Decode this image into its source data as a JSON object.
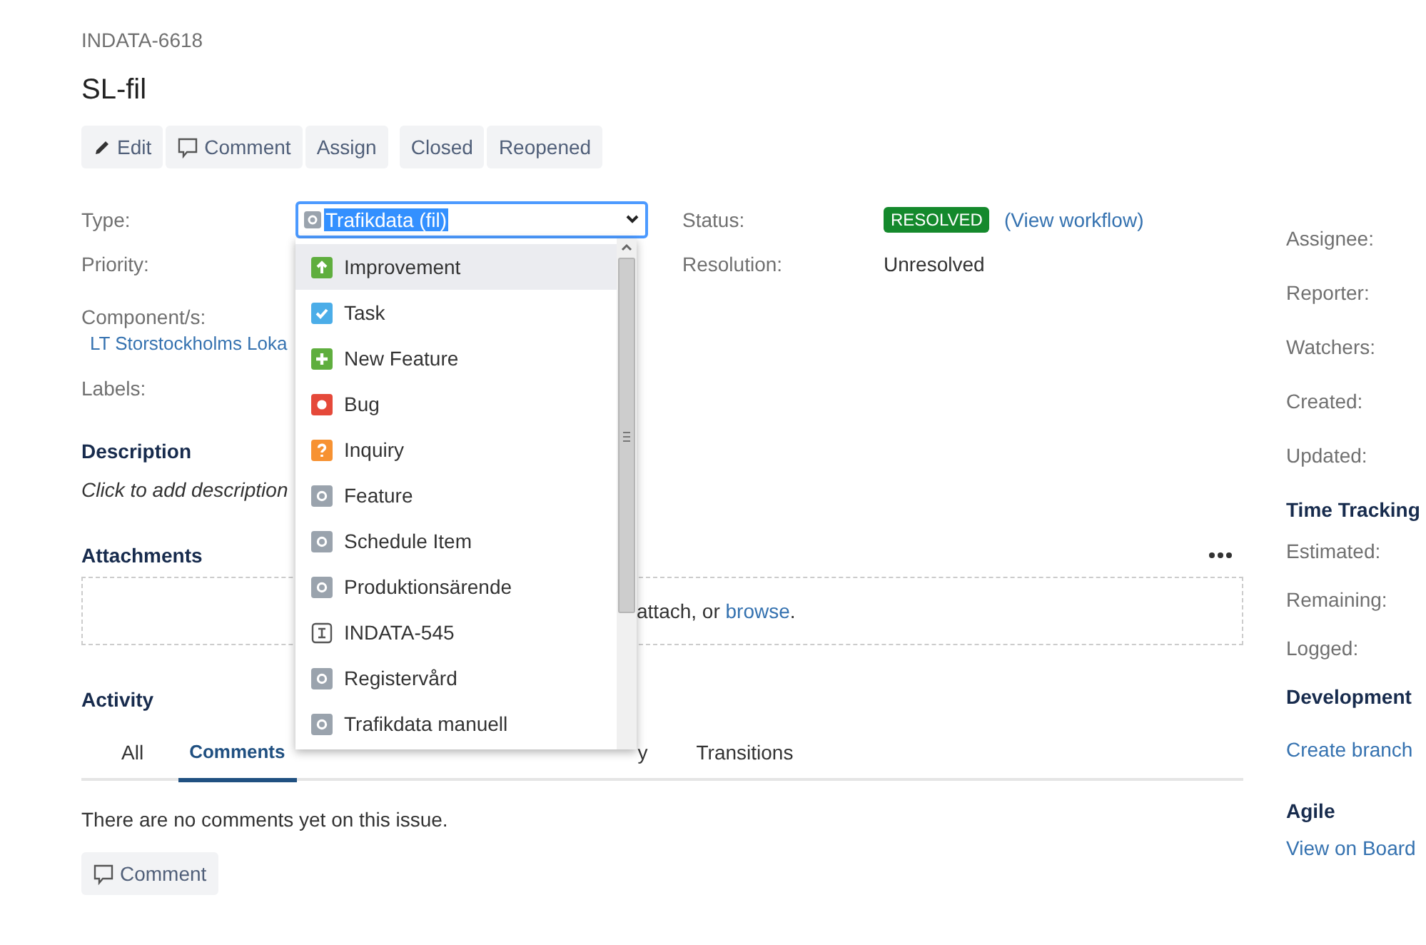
{
  "issue_key": "INDATA-6618",
  "title": "SL-fil",
  "actions": [
    {
      "label": "Edit",
      "kind": "pencil"
    },
    {
      "label": "Comment",
      "kind": "comment"
    },
    {
      "label": "Assign",
      "kind": "plain"
    }
  ],
  "workflow": [
    {
      "label": "Closed"
    },
    {
      "label": "Reopened"
    }
  ],
  "details": {
    "type_label": "Type:",
    "type_value": "Trafikdata (fil)",
    "priority_label": "Priority:",
    "components_label": "Component/s:",
    "component": "LT Storstockholms Loka",
    "labels_label": "Labels:",
    "status_label": "Status:",
    "status": "RESOLVED",
    "workflow_link": "(View workflow)",
    "resolution_label": "Resolution:",
    "resolution": "Unresolved"
  },
  "type_options": [
    {
      "label": "Improvement",
      "kind": "improvement",
      "selected": true
    },
    {
      "label": "Task",
      "kind": "task",
      "selected": false
    },
    {
      "label": "New Feature",
      "kind": "feature",
      "selected": false
    },
    {
      "label": "Bug",
      "kind": "bug",
      "selected": false
    },
    {
      "label": "Inquiry",
      "kind": "inquiry",
      "selected": false
    },
    {
      "label": "Feature",
      "kind": "generic",
      "selected": false
    },
    {
      "label": "Schedule Item",
      "kind": "generic",
      "selected": false
    },
    {
      "label": "Produktionsärende",
      "kind": "generic",
      "selected": false
    },
    {
      "label": "INDATA-545",
      "kind": "text",
      "selected": false
    },
    {
      "label": "Registervård",
      "kind": "generic",
      "selected": false
    },
    {
      "label": "Trafikdata manuell",
      "kind": "generic",
      "selected": false
    }
  ],
  "description": {
    "heading": "Description",
    "placeholder": "Click to add description"
  },
  "attachments": {
    "heading": "Attachments",
    "drop_text": "attach, or ",
    "browse_link": "browse",
    "drop_end": "."
  },
  "activity": {
    "heading": "Activity",
    "tabs": [
      {
        "label": "All",
        "selected": false
      },
      {
        "label": "Comments",
        "selected": true
      },
      {
        "label": "y",
        "selected": false
      },
      {
        "label": "Transitions",
        "selected": false
      }
    ],
    "empty_message": "There are no comments yet on this issue.",
    "comment_button": "Comment"
  },
  "sidebar": {
    "people": [
      "Assignee:",
      "Reporter:",
      "Watchers:"
    ],
    "dates": [
      "Created:",
      "Updated:"
    ],
    "time_tracking": {
      "heading": "Time Tracking",
      "labels": [
        "Estimated:",
        "Remaining:",
        "Logged:"
      ]
    },
    "development": {
      "heading": "Development",
      "link": "Create branch"
    },
    "agile": {
      "heading": "Agile",
      "link": "View on Board"
    }
  }
}
